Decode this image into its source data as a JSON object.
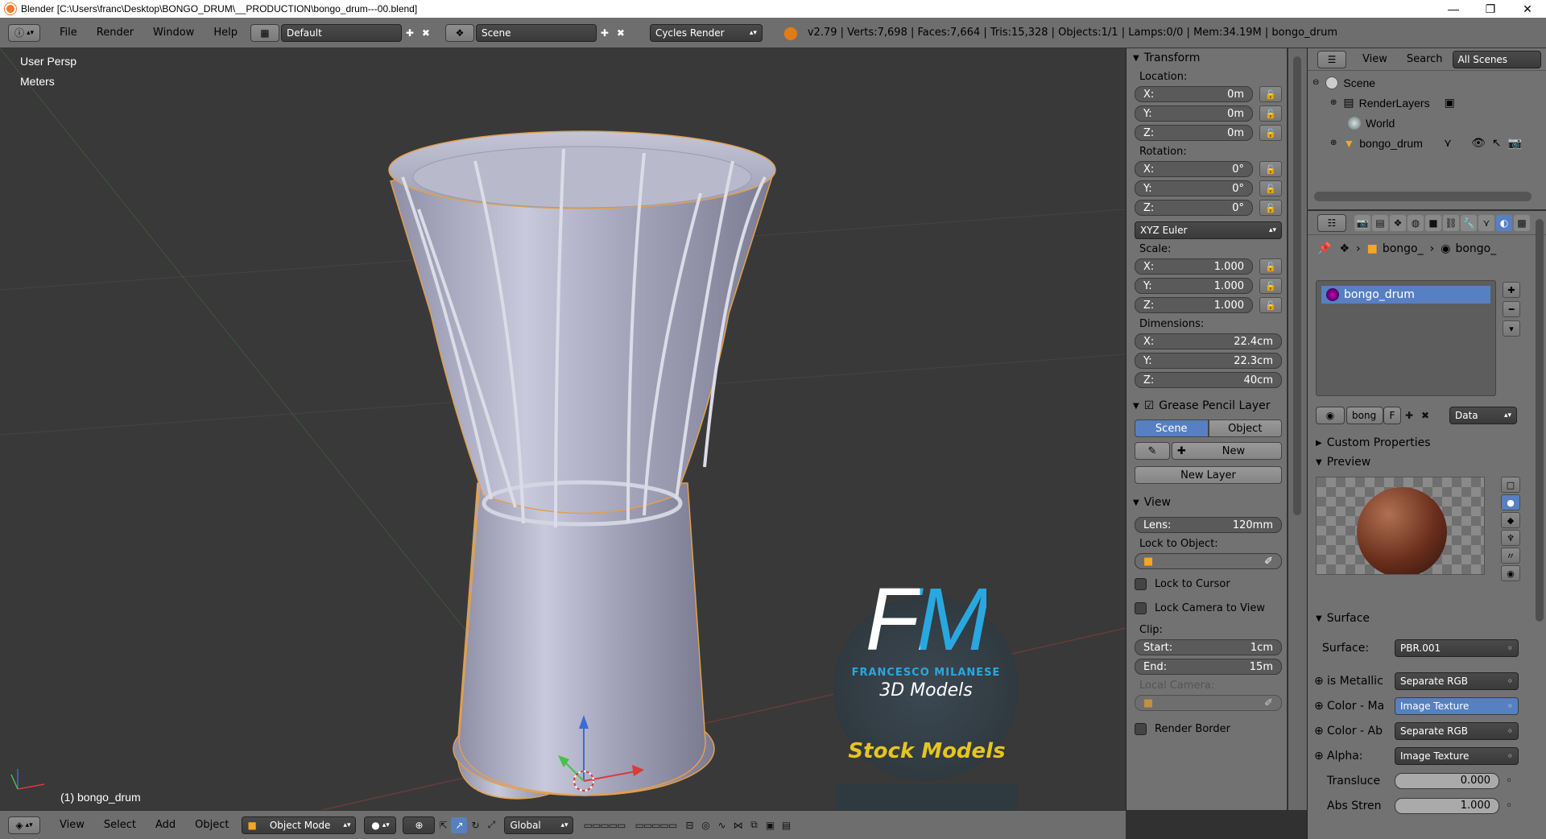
{
  "window": {
    "title": "Blender [C:\\Users\\franc\\Desktop\\BONGO_DRUM\\__PRODUCTION\\bongo_drum---00.blend]",
    "minimize": "—",
    "maximize": "❐",
    "close": "✕"
  },
  "topbar": {
    "menus": [
      "File",
      "Render",
      "Window",
      "Help"
    ],
    "layout": "Default",
    "scene": "Scene",
    "engine": "Cycles Render",
    "stats": "v2.79 | Verts:7,698 | Faces:7,664 | Tris:15,328 | Objects:1/1 | Lamps:0/0 | Mem:34.19M | bongo_drum"
  },
  "viewport": {
    "view_name": "User Persp",
    "units": "Meters",
    "object_label": "(1) bongo_drum",
    "watermark": {
      "big": "FM",
      "sub": "FRANCESCO MILANESE",
      "line": "3D Models",
      "banner": "Stock Models"
    }
  },
  "bottombar": {
    "menus": [
      "View",
      "Select",
      "Add",
      "Object"
    ],
    "mode": "Object Mode",
    "orientation": "Global"
  },
  "npanel": {
    "transform_title": "Transform",
    "location_label": "Location:",
    "location": [
      {
        "axis": "X:",
        "value": "0m"
      },
      {
        "axis": "Y:",
        "value": "0m"
      },
      {
        "axis": "Z:",
        "value": "0m"
      }
    ],
    "rotation_label": "Rotation:",
    "rotation": [
      {
        "axis": "X:",
        "value": "0°"
      },
      {
        "axis": "Y:",
        "value": "0°"
      },
      {
        "axis": "Z:",
        "value": "0°"
      }
    ],
    "rotation_mode": "XYZ Euler",
    "scale_label": "Scale:",
    "scale": [
      {
        "axis": "X:",
        "value": "1.000"
      },
      {
        "axis": "Y:",
        "value": "1.000"
      },
      {
        "axis": "Z:",
        "value": "1.000"
      }
    ],
    "dimensions_label": "Dimensions:",
    "dimensions": [
      {
        "axis": "X:",
        "value": "22.4cm"
      },
      {
        "axis": "Y:",
        "value": "22.3cm"
      },
      {
        "axis": "Z:",
        "value": "40cm"
      }
    ],
    "grease_title": "Grease Pencil Layer",
    "grease_tab_scene": "Scene",
    "grease_tab_object": "Object",
    "grease_new": "New",
    "grease_new_layer": "New Layer",
    "view_title": "View",
    "lens_label": "Lens:",
    "lens_value": "120mm",
    "lock_object_label": "Lock to Object:",
    "lock_cursor": "Lock to Cursor",
    "lock_camera": "Lock Camera to View",
    "clip_label": "Clip:",
    "clip_start_label": "Start:",
    "clip_start_value": "1cm",
    "clip_end_label": "End:",
    "clip_end_value": "15m",
    "local_camera": "Local Camera:",
    "render_border": "Render Border"
  },
  "outliner": {
    "header_view": "View",
    "header_search": "Search",
    "header_scope": "All Scenes",
    "items": [
      {
        "label": "Scene"
      },
      {
        "label": "RenderLayers"
      },
      {
        "label": "World"
      },
      {
        "label": "bongo_drum"
      }
    ]
  },
  "properties": {
    "breadcrumb_a": "bongo_",
    "breadcrumb_b": "bongo_",
    "material_slot": "bongo_drum",
    "datablock_name": "bong",
    "fake_user": "F",
    "link_mode": "Data",
    "custom_props": "Custom Properties",
    "preview": "Preview",
    "surface_title": "Surface",
    "surface_label": "Surface:",
    "surface_value": "PBR.001",
    "inputs": [
      {
        "label": "is Metallic",
        "value": "Separate RGB"
      },
      {
        "label": "Color - Ma",
        "value": "Image Texture"
      },
      {
        "label": "Color - Ab",
        "value": "Separate RGB"
      },
      {
        "label": "Alpha:",
        "value": "Image Texture"
      }
    ],
    "translucence_label": "Transluce",
    "translucence_value": "0.000",
    "abs_label": "Abs Stren",
    "abs_value": "1.000"
  },
  "colors": {
    "selection": "#5680c2",
    "active_tab": "#5680c2",
    "orange": "#f5a623"
  }
}
